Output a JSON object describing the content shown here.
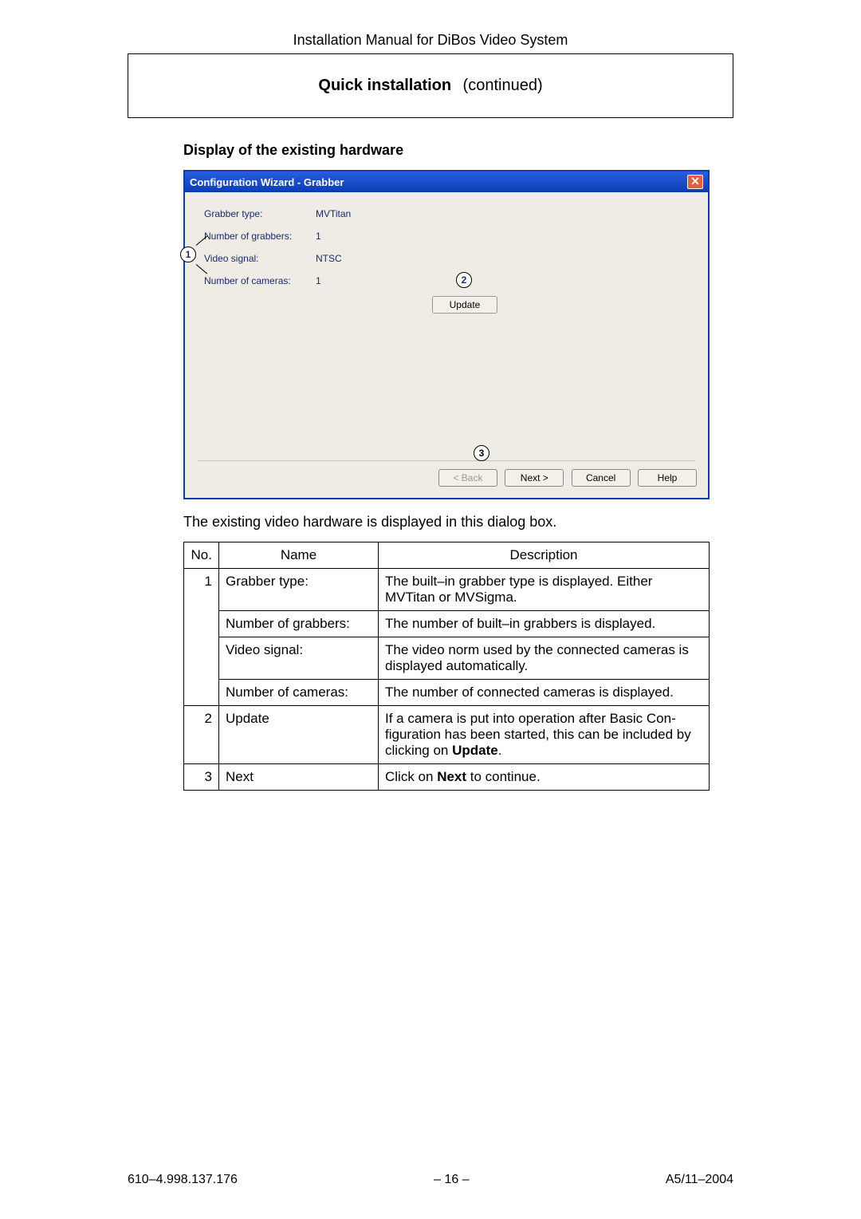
{
  "header": {
    "title": "Installation Manual for DiBos Video System"
  },
  "section": {
    "title_bold": "Quick installation",
    "title_cont": "(continued)"
  },
  "subheading": "Display of the existing hardware",
  "dialog": {
    "title": "Configuration Wizard  - Grabber",
    "close_glyph": "✕",
    "rows": [
      {
        "label": "Grabber type:",
        "value": "MVTitan"
      },
      {
        "label": "Number of grabbers:",
        "value": "1"
      },
      {
        "label": "Video signal:",
        "value": "NTSC"
      },
      {
        "label": "Number of cameras:",
        "value": "1"
      }
    ],
    "update_btn": "Update",
    "buttons": {
      "back": "< Back",
      "next": "Next >",
      "cancel": "Cancel",
      "help": "Help"
    },
    "callouts": {
      "c1": "1",
      "c2": "2",
      "c3": "3"
    }
  },
  "caption": "The existing video hardware is displayed in this dialog box.",
  "table": {
    "headers": {
      "no": "No.",
      "name": "Name",
      "desc": "Description"
    },
    "rows": [
      {
        "no": "1",
        "name": "Grabber type:",
        "desc_pre": "The built–in grabber type is displayed. Either MVTitan or MVSigma."
      },
      {
        "no": "",
        "name": "Number of grabbers:",
        "desc_pre": "The number of built–in grabbers is displayed."
      },
      {
        "no": "",
        "name": "Video signal:",
        "desc_pre": "The video norm used by the connected cameras is displayed automatically."
      },
      {
        "no": "",
        "name": "Number of cameras:",
        "desc_pre": "The number of connected cameras is displayed."
      },
      {
        "no": "2",
        "name": "Update",
        "desc_pre": "If a camera is put into operation after Basic Con­figuration has been started, this can be included by clicking on ",
        "bold": "Update",
        "desc_post": "."
      },
      {
        "no": "3",
        "name": "Next",
        "desc_pre": "Click on ",
        "bold": "Next",
        "desc_post": " to continue."
      }
    ]
  },
  "footer": {
    "left": "610–4.998.137.176",
    "center": "–  16  –",
    "right": "A5/11–2004"
  }
}
